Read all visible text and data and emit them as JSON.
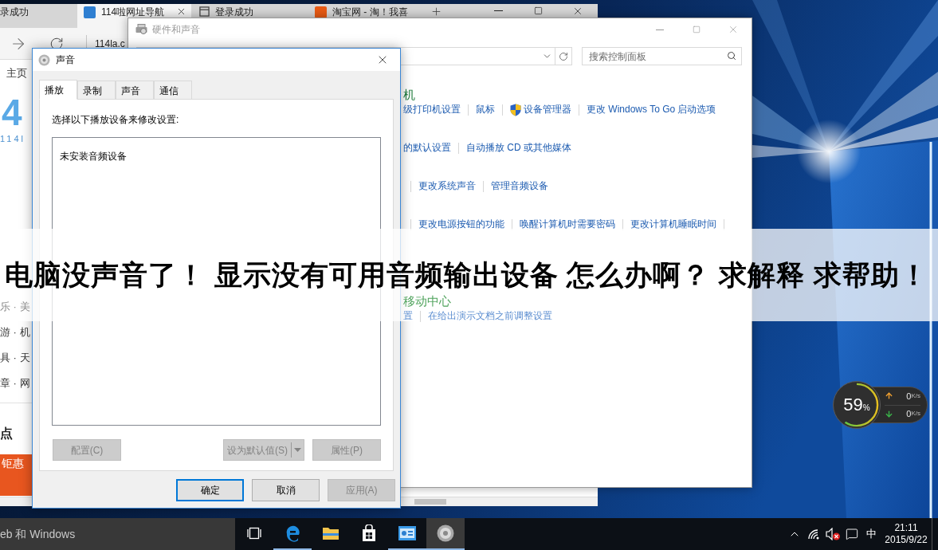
{
  "browser": {
    "tabs": [
      {
        "label": "录成功",
        "selected": false,
        "kind": "none"
      },
      {
        "label": "114啦网址导航",
        "selected": true,
        "kind": "site",
        "color": "#2f7fd1"
      },
      {
        "label": "登录成功",
        "selected": false,
        "kind": "page"
      },
      {
        "label": "淘宝网 - 淘！我喜",
        "selected": false,
        "kind": "site",
        "color": "#e85a14"
      }
    ],
    "address": "114la.c",
    "page": {
      "home_link": "主页",
      "logo": {
        "mark": "4",
        "text": "114l"
      },
      "nav_rows": [
        "乐 · 美",
        "游 · 机",
        "具 · 天",
        "章 · 网"
      ],
      "section_title": "点",
      "ad_text": "钜惠"
    }
  },
  "control_panel": {
    "title": "硬件和声音",
    "search": {
      "placeholder": "搜索控制面板"
    },
    "sections": [
      {
        "heading": "机",
        "leading_separator": false,
        "trailing_separator": false,
        "links": [
          {
            "label": "级打印机设置",
            "kind": "plain"
          },
          {
            "label": "鼠标",
            "kind": "plain"
          },
          {
            "label": "设备管理器",
            "kind": "admin"
          },
          {
            "label": "更改 Windows To Go 启动选项",
            "kind": "plain"
          }
        ]
      },
      {
        "leading_separator": false,
        "trailing_separator": false,
        "links": [
          {
            "label": "的默认设置",
            "kind": "plain"
          },
          {
            "label": "自动播放 CD 或其他媒体",
            "kind": "plain"
          }
        ]
      },
      {
        "leading_separator": true,
        "trailing_separator": false,
        "links": [
          {
            "label": "更改系统声音",
            "kind": "plain"
          },
          {
            "label": "管理音频设备",
            "kind": "plain"
          }
        ]
      },
      {
        "leading_separator": true,
        "trailing_separator": true,
        "links": [
          {
            "label": "更改电源按钮的功能",
            "kind": "plain"
          },
          {
            "label": "唤醒计算机时需要密码",
            "kind": "plain"
          },
          {
            "label": "更改计算机睡眠时间",
            "kind": "plain"
          }
        ]
      }
    ],
    "lower_sections": [
      {
        "heading": "移动中心",
        "leading_separator": false,
        "trailing_separator": false,
        "links": [
          {
            "label": "置",
            "kind": "plain"
          },
          {
            "label": "在给出演示文档之前调整设置",
            "kind": "plain"
          }
        ]
      }
    ]
  },
  "sound_dialog": {
    "title": "声音",
    "tabs": [
      {
        "label": "播放",
        "selected": true
      },
      {
        "label": "录制",
        "selected": false
      },
      {
        "label": "声音",
        "selected": false
      },
      {
        "label": "通信",
        "selected": false
      }
    ],
    "instruction": "选择以下播放设备来修改设置:",
    "empty_list": "未安装音频设备",
    "device_buttons": [
      {
        "label": "配置(C)",
        "kind": "plain",
        "disabled": true
      },
      {
        "label": "设为默认值(S)",
        "kind": "split",
        "disabled": true
      },
      {
        "label": "属性(P)",
        "kind": "plain",
        "disabled": true
      }
    ],
    "footer_buttons": [
      {
        "label": "确定",
        "disabled": false,
        "default": true
      },
      {
        "label": "取消",
        "disabled": false,
        "default": false
      },
      {
        "label": "应用(A)",
        "disabled": true,
        "default": false
      }
    ]
  },
  "caption": "电脑没声音了！ 显示没有可用音频输出设备 怎么办啊？ 求解释 求帮助！",
  "memory_widget": {
    "percent": "59",
    "unit": "%",
    "upload": {
      "value": "0",
      "unit": "K/s"
    },
    "download": {
      "value": "0",
      "unit": "K/s"
    }
  },
  "taskbar": {
    "search": {
      "placeholder": "eb 和 Windows"
    },
    "apps": [
      {
        "kind": "task-view",
        "running": false,
        "selected": false
      },
      {
        "kind": "edge",
        "running": true,
        "selected": false
      },
      {
        "kind": "explorer",
        "running": false,
        "selected": false
      },
      {
        "kind": "store",
        "running": false,
        "selected": false
      },
      {
        "kind": "control-panel",
        "running": true,
        "selected": false
      },
      {
        "kind": "sound",
        "running": true,
        "selected": true
      }
    ],
    "tray": {
      "ime": "中",
      "time": "21:11",
      "date": "2015/9/22"
    }
  }
}
